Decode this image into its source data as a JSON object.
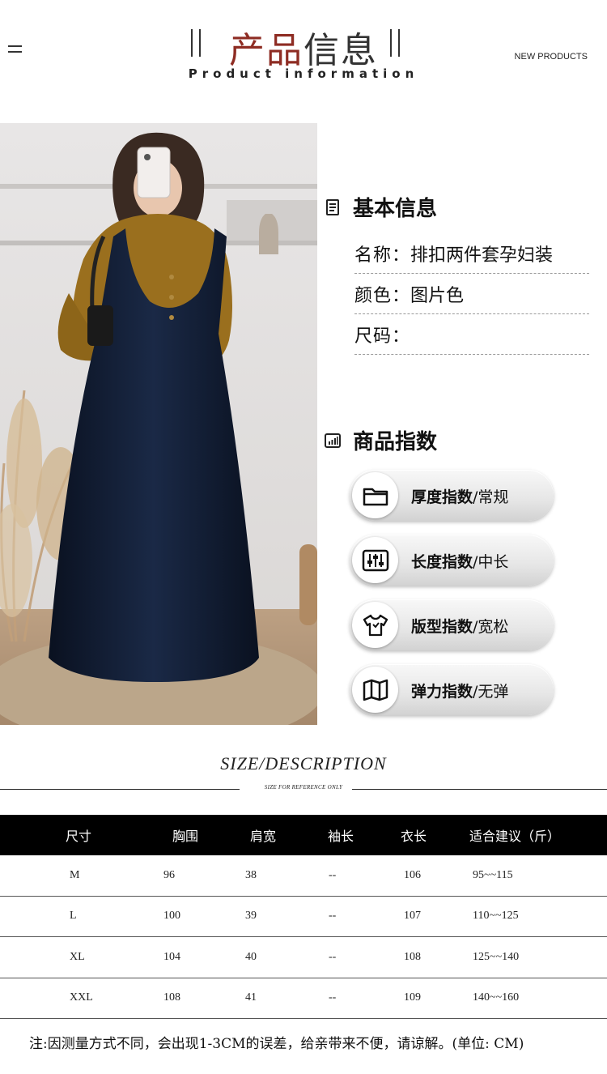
{
  "header": {
    "title_accent": "产品",
    "title_rest": "信息",
    "subtitle": "Product information",
    "tag": "NEW PRODUCTS"
  },
  "basic_info": {
    "heading": "基本信息",
    "icon": "document-icon",
    "rows": [
      {
        "label": "名称：",
        "value": "排扣两件套孕妇装"
      },
      {
        "label": "颜色：",
        "value": "图片色"
      },
      {
        "label": "尺码：",
        "value": ""
      }
    ]
  },
  "product_index": {
    "heading": "商品指数",
    "icon": "bar-chart-icon",
    "items": [
      {
        "icon": "folder-icon",
        "label": "厚度指数",
        "value": "/常规"
      },
      {
        "icon": "sliders-icon",
        "label": "长度指数",
        "value": "/中长"
      },
      {
        "icon": "tshirt-icon",
        "label": "版型指数",
        "value": "/宽松"
      },
      {
        "icon": "map-icon",
        "label": "弹力指数",
        "value": "/无弹"
      }
    ]
  },
  "size_section": {
    "heading": "SIZE/DESCRIPTION",
    "note": "SIZE FOR REFERENCE ONLY",
    "headers": [
      "尺寸",
      "胸围",
      "肩宽",
      "袖长",
      "衣长",
      "适合建议（斤）"
    ],
    "rows": [
      [
        "M",
        "96",
        "38",
        "--",
        "106",
        "95~~115"
      ],
      [
        "L",
        "100",
        "39",
        "--",
        "107",
        "110~~125"
      ],
      [
        "XL",
        "104",
        "40",
        "--",
        "108",
        "125~~140"
      ],
      [
        "XXL",
        "108",
        "41",
        "--",
        "109",
        "140~~160"
      ]
    ],
    "footnote": "注:因测量方式不同，会出现1-3CM的误差，给亲带来不便，请谅解。(单位: CM)"
  },
  "colors": {
    "accent": "#8e2c23",
    "table_header_bg": "#000000",
    "dress": "#0d1628",
    "sweater": "#9a6f1e"
  }
}
